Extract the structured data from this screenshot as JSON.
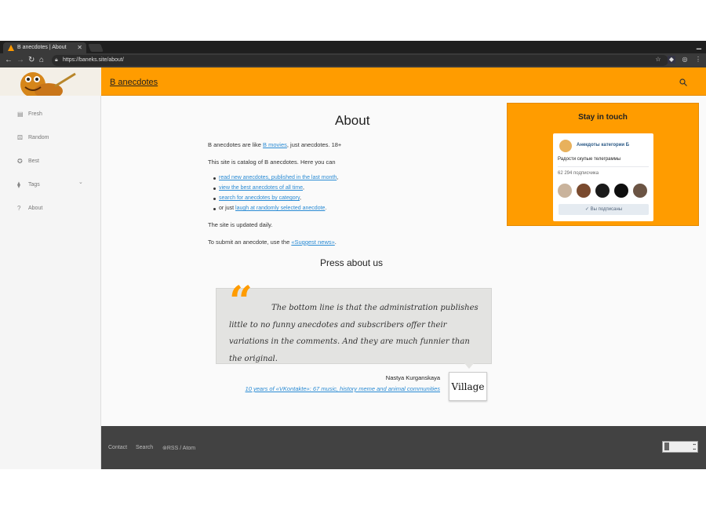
{
  "browser": {
    "tab_title": "B anecdotes | About",
    "url": "https://baneks.site/about/"
  },
  "header": {
    "brand": "B anecdotes"
  },
  "sidebar": {
    "items": [
      {
        "label": "Fresh",
        "icon": "newspaper-icon"
      },
      {
        "label": "Random",
        "icon": "dice-icon"
      },
      {
        "label": "Best",
        "icon": "star-icon"
      },
      {
        "label": "Tags",
        "icon": "tag-icon"
      },
      {
        "label": "About",
        "icon": "help-icon"
      }
    ]
  },
  "main": {
    "title": "About",
    "intro_pre": "B anecdotes are like ",
    "intro_link": "B movies",
    "intro_post": ", just anecdotes. 18+",
    "catalog_text": "This site is catalog of B anecdotes. Here you can",
    "list": [
      {
        "pre": "",
        "link": "read new anecdotes, published in the last month",
        "post": ","
      },
      {
        "pre": "",
        "link": "view the best anecdotes of all time",
        "post": ","
      },
      {
        "pre": "",
        "link": "search for anecdotes by category",
        "post": ","
      },
      {
        "pre": "or just ",
        "link": "laugh at randomly selected anecdote",
        "post": "."
      }
    ],
    "updated_text": "The site is updated daily.",
    "submit_pre": "To submit an anecdote, use the ",
    "submit_link": "«Suggest news»",
    "submit_post": ".",
    "press_title": "Press about us",
    "quote_text": "The bottom line is that the administration publishes little to no funny anecdotes and subscribers offer their variations in the comments. And they are much funnier than the original.",
    "quote_author": "Nastya Kurganskaya",
    "quote_source": "10 years of «VKontakte»: 67 music, history meme and animal communities",
    "press_logo": "Village"
  },
  "stay": {
    "title": "Stay in touch",
    "group_name": "Анекдоты категории Б",
    "group_desc": "Радости скупые телеграммы",
    "subscribers": "62 294 подписчика",
    "subscribed_label": "Вы подписаны"
  },
  "footer": {
    "links": [
      "Contact",
      "Search",
      "RSS / Atom"
    ]
  },
  "colors": {
    "accent": "#ff9c00",
    "link": "#2a8bd4",
    "footer_bg": "#424242"
  }
}
